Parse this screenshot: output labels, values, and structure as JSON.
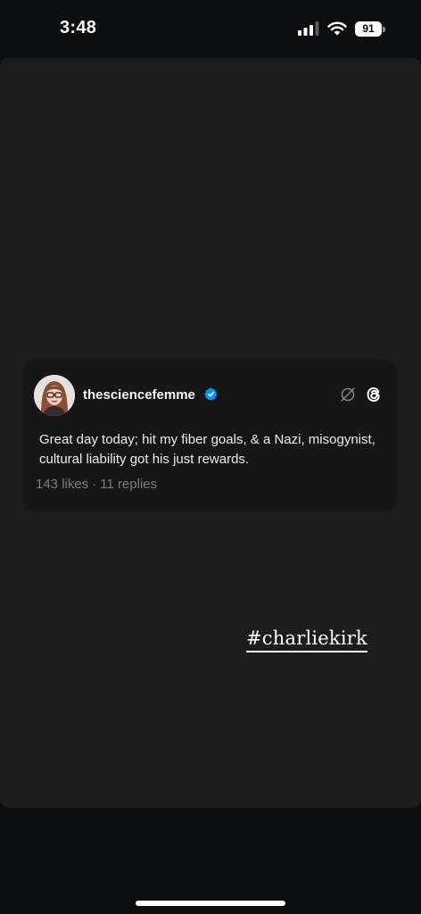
{
  "status_bar": {
    "time": "3:48",
    "battery_level": "91",
    "cellular_bars_filled": 3,
    "cellular_bars_total": 4
  },
  "post": {
    "username": "thesciencefemme",
    "verified": true,
    "text": "Great day today; hit my fiber goals, & a Nazi, misogynist, cultural liability got his just rewards.",
    "likes": "143 likes",
    "separator": "·",
    "replies": "11 replies",
    "icons": [
      "avatar-photo",
      "verified-badge-icon",
      "mute-icon",
      "threads-logo-icon"
    ]
  },
  "sticker": {
    "hashtag": "#charliekirk"
  },
  "colors": {
    "background": "#0c0e10",
    "story_canvas": "#1d1d1d",
    "card": "#161616",
    "verified_blue": "#0095f6",
    "muted_text": "#7c7c7c"
  }
}
